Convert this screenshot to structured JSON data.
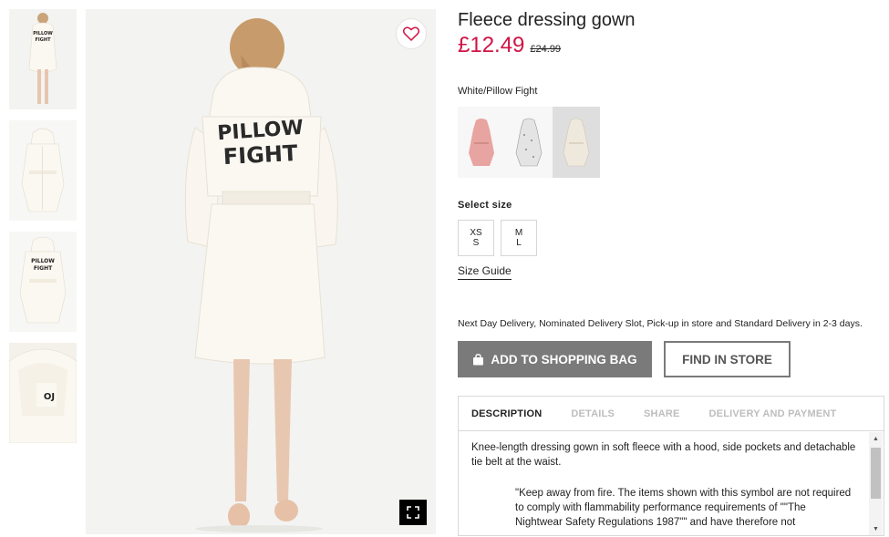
{
  "product": {
    "title": "Fleece dressing gown",
    "price": "£12.49",
    "old_price": "£24.99",
    "color_label": "White/Pillow Fight"
  },
  "gallery": {
    "back_print_line1": "PILLOW",
    "back_print_line2": "FIGHT",
    "thumb_print_line1": "PILLOW",
    "thumb_print_line2": "FIGHT"
  },
  "colors": {
    "accent_price": "#d01345",
    "add_button_bg": "#7a7a7a",
    "swatches": [
      "#e8a4a0",
      "#e4e4e4",
      "#efe8dc"
    ]
  },
  "sizes": {
    "label": "Select size",
    "options": [
      {
        "line1": "XS",
        "line2": "S"
      },
      {
        "line1": "M",
        "line2": "L"
      }
    ],
    "guide_label": "Size Guide"
  },
  "delivery_text": "Next Day Delivery, Nominated Delivery Slot, Pick-up in store and Standard Delivery in 2-3 days.",
  "actions": {
    "add_to_bag": "ADD TO SHOPPING BAG",
    "find_in_store": "FIND IN STORE"
  },
  "tabs": [
    {
      "label": "DESCRIPTION",
      "active": true
    },
    {
      "label": "DETAILS",
      "active": false
    },
    {
      "label": "SHARE",
      "active": false
    },
    {
      "label": "DELIVERY AND PAYMENT",
      "active": false
    }
  ],
  "description": {
    "paragraph": "Knee-length dressing gown in soft fleece with a hood, side pockets and detachable tie belt at the waist.",
    "quote": "\"Keep away from fire. The items shown with this symbol are not required to comply with flammability performance requirements of \"\"The Nightwear Safety Regulations 1987\"\" and have therefore not"
  },
  "icons": {
    "favourite": "heart-icon",
    "expand": "fullscreen-icon",
    "bag": "shopping-bag-icon",
    "scroll_up": "▲",
    "scroll_down": "▼"
  }
}
